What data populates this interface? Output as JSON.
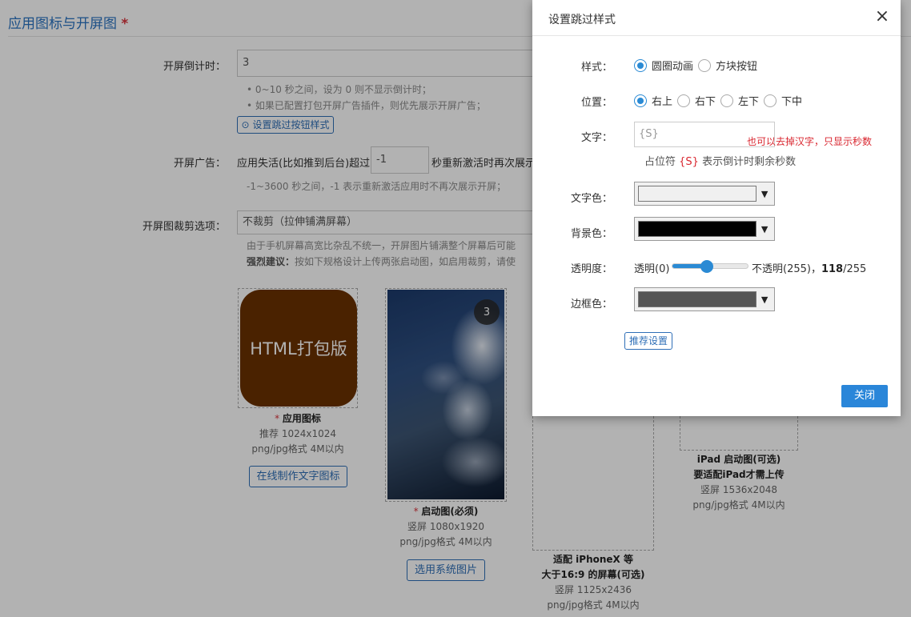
{
  "section": {
    "title": "应用图标与开屏图",
    "required_mark": "*"
  },
  "countdown": {
    "label": "开屏倒计时：",
    "value": "3",
    "hint1": "• 0~10 秒之间，设为 0 则不显示倒计时；",
    "hint2": "• 如果已配置打包开屏广告插件，则优先展示开屏广告；",
    "skip_button": "设置跳过按钮样式"
  },
  "splash_ad": {
    "label": "开屏广告：",
    "prefix": "应用失活(比如推到后台)超过",
    "value": "-1",
    "suffix": "秒重新激活时再次展示",
    "hint": "-1~3600 秒之间，-1 表示重新激活应用时不再次展示开屏；"
  },
  "crop": {
    "label": "开屏图裁剪选项：",
    "value": "不裁剪（拉伸铺满屏幕）",
    "hint1": "由于手机屏幕高宽比杂乱不统一，开屏图片铺满整个屏幕后可能",
    "hint2_bold": "强烈建议：",
    "hint2": "按如下规格设计上传两张启动图，如启用裁剪，请使"
  },
  "images": {
    "app_icon": {
      "text": "HTML打包版",
      "required": "*",
      "title": "应用图标",
      "size": "推荐 1024x1024",
      "format": "png/jpg格式 4M以内",
      "button": "在线制作文字图标",
      "bg_color": "#6b3200"
    },
    "splash": {
      "badge": "3",
      "required": "*",
      "title": "启动图(必须)",
      "size": "竖屏 1080x1920",
      "format": "png/jpg格式 4M以内",
      "button": "选用系统图片"
    },
    "iphonex": {
      "title1": "适配 iPhoneX 等",
      "title2": "大于16:9 的屏幕(可选)",
      "size": "竖屏 1125x2436",
      "format": "png/jpg格式 4M以内"
    },
    "ipad": {
      "title1": "iPad 启动图(可选)",
      "title2": "要适配iPad才需上传",
      "size": "竖屏 1536x2048",
      "format": "png/jpg格式 4M以内"
    }
  },
  "dialog": {
    "title": "设置跳过样式",
    "close_icon": "×",
    "style": {
      "label": "样式：",
      "options": [
        "圆圈动画",
        "方块按钮"
      ],
      "selected": 0
    },
    "position": {
      "label": "位置：",
      "options": [
        "右上",
        "右下",
        "左下",
        "下中"
      ],
      "selected": 0
    },
    "text": {
      "label": "文字：",
      "value": "{S}",
      "red_note": "也可以去掉汉字，只显示秒数",
      "note_prefix": "占位符",
      "note_token": "{S}",
      "note_suffix": "表示倒计时剩余秒数"
    },
    "text_color": {
      "label": "文字色：",
      "color": "#f0f0f0"
    },
    "bg_color": {
      "label": "背景色：",
      "color": "#000000"
    },
    "opacity": {
      "label": "透明度：",
      "min_label": "透明(0)",
      "max_label": "不透明(255)，",
      "value": "118",
      "max": "/255",
      "fraction": 0.4627
    },
    "border_color": {
      "label": "边框色：",
      "color": "#555555"
    },
    "recommend_button": "推荐设置",
    "close_button": "关闭",
    "accent_color": "#2a86d9"
  }
}
